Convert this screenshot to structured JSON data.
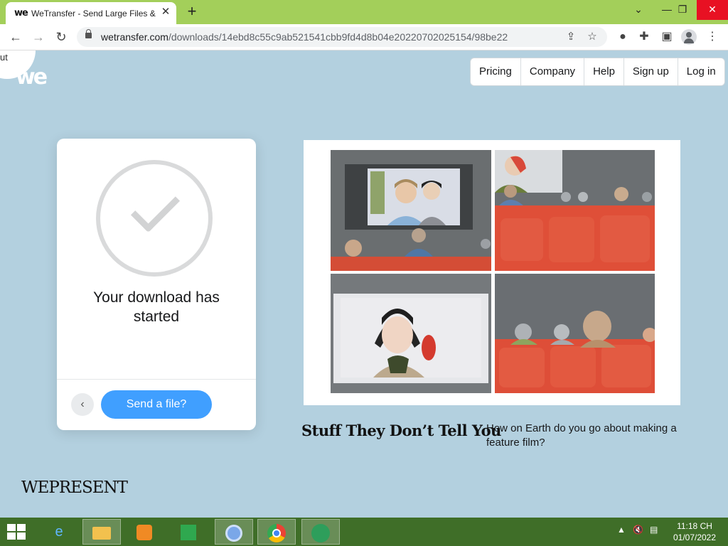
{
  "browser": {
    "tab_title": "WeTransfer - Send Large Files &",
    "tab_favicon": "we",
    "url_host": "wetransfer.com",
    "url_path": "/downloads/14ebd8c55c9ab521541cbb9fd4d8b04e20220702025154/98be22",
    "tabbar_color": "#a3cf5a"
  },
  "page": {
    "corner_text": "ut",
    "logo": "we",
    "nav": [
      "Pricing",
      "Company",
      "Help",
      "Sign up",
      "Log in"
    ],
    "status_message": "Your download has started",
    "send_button": "Send a file?",
    "feature_title": "Stuff They Don’t Tell You",
    "feature_description": "How on Earth do you go about making a feature film?",
    "brand_footer": "WEPRESENT",
    "accent": "#409fff",
    "background": "#b3d0df"
  },
  "taskbar": {
    "items": [
      "internet-explorer-icon",
      "file-explorer-icon",
      "media-player-icon",
      "store-icon",
      "chromium-icon",
      "chrome-icon",
      "downloader-icon"
    ],
    "time": "11:18 CH",
    "date": "01/07/2022"
  }
}
